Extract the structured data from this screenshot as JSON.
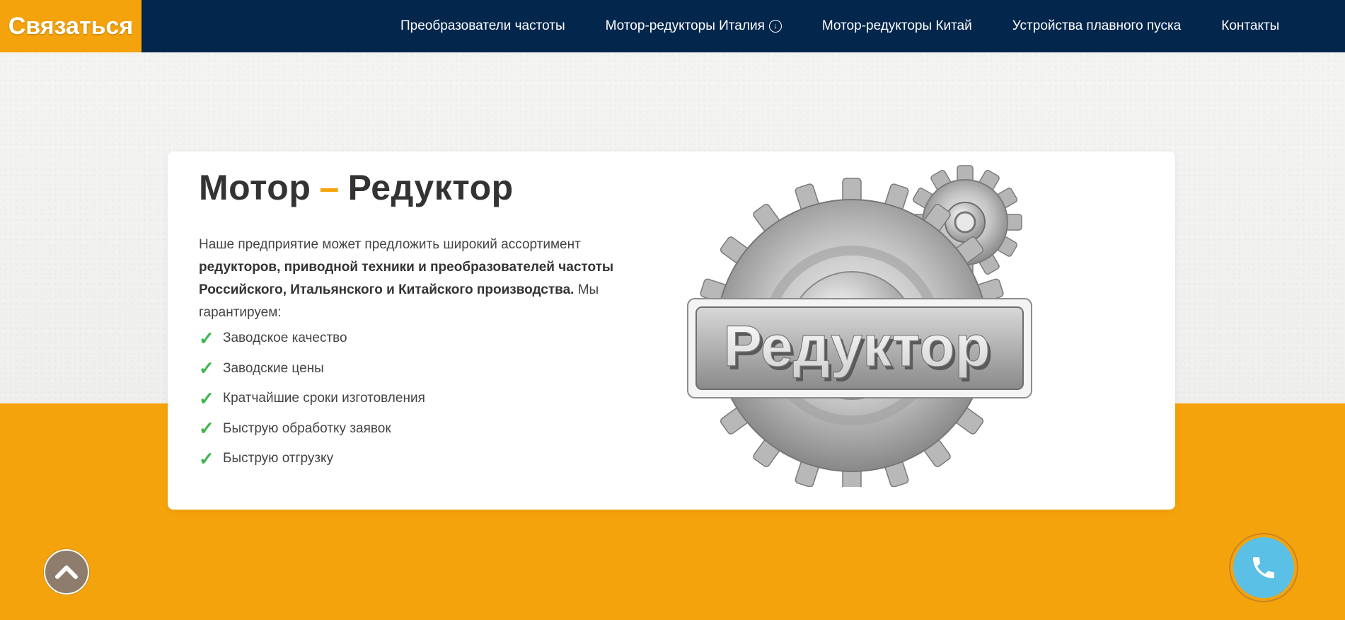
{
  "header": {
    "contact_label": "Связаться",
    "nav": [
      {
        "label": "Преобразователи частоты"
      },
      {
        "label": "Мотор-редукторы Италия",
        "has_dropdown": true
      },
      {
        "label": "Мотор-редукторы Китай"
      },
      {
        "label": "Устройства плавного пуска"
      },
      {
        "label": "Контакты"
      }
    ]
  },
  "hero": {
    "title_part1": "Мотор",
    "title_dash": "–",
    "title_part2": "Редуктор",
    "intro_plain1": "Наше предприятие может предложить широкий ассортимент ",
    "intro_bold": "редукторов, приводной техники и преобразователей частоты Российского, Итальянского и Китайского производства.",
    "intro_plain2": " Мы гарантируем:",
    "checklist": [
      "Заводское качество",
      "Заводские цены",
      "Кратчайшие сроки изготовления",
      "Быструю обработку заявок",
      "Быструю отгрузку"
    ],
    "check_glyph": "✓",
    "image_sign_text": "Редуктор"
  },
  "icons": {
    "scroll_top": "chevron-up-icon",
    "call": "phone-icon",
    "dropdown": "chevron-down-circle-icon"
  },
  "colors": {
    "navbar": "#03264c",
    "accent_orange": "#f5a30c",
    "check_green": "#3ab54a",
    "call_button": "#5bc0e5",
    "scroll_button": "#8e7d6c"
  }
}
